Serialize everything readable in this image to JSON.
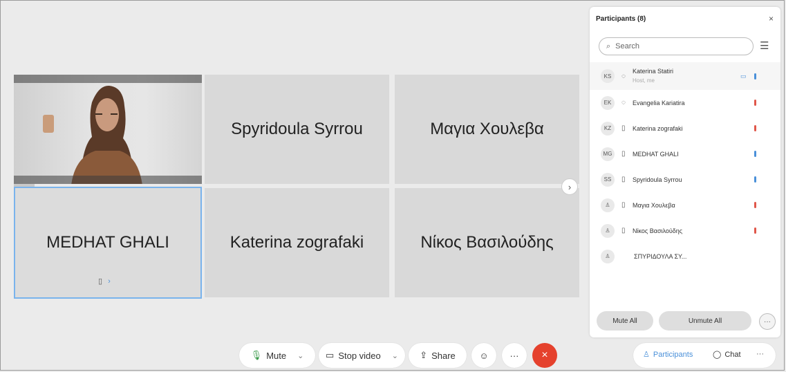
{
  "grid": {
    "tiles": [
      {
        "name": "Spyridoula Syrrou"
      },
      {
        "name": "Μαγια Χουλεβα"
      },
      {
        "name": "MEDHAT GHALI"
      },
      {
        "name": "Katerina zografaki"
      },
      {
        "name": "Νίκος Βασιλούδης"
      }
    ],
    "next_icon": "chevron-right-icon"
  },
  "controls": {
    "mute_label": "Mute",
    "stop_video_label": "Stop video",
    "share_label": "Share",
    "more_label": "···",
    "end_icon": "×"
  },
  "panel": {
    "title": "Participants (8)",
    "close": "×",
    "search_placeholder": "Search",
    "participants": [
      {
        "initials": "KS",
        "name": "Katerina Statiri",
        "sub": "Host, me",
        "mic": "blue",
        "video": true
      },
      {
        "initials": "EK",
        "name": "Evangelia Kariatira",
        "sub": "",
        "mic": "red"
      },
      {
        "initials": "KZ",
        "name": "Katerina zografaki",
        "sub": "",
        "mic": "red"
      },
      {
        "initials": "MG",
        "name": "MEDHAT GHALI",
        "sub": "",
        "mic": "blue"
      },
      {
        "initials": "SS",
        "name": "Spyridoula Syrrou",
        "sub": "",
        "mic": "blue"
      },
      {
        "initials": "",
        "name": "Μαγια Χουλεβα",
        "sub": "",
        "mic": "red"
      },
      {
        "initials": "",
        "name": "Νίκος Βασιλούδης",
        "sub": "",
        "mic": "red"
      },
      {
        "initials": "",
        "name": "ΣΠΥΡΙΔΟΥΛΑ ΣΥ...",
        "sub": "",
        "mic": ""
      }
    ],
    "mute_all": "Mute All",
    "unmute_all": "Unmute All",
    "more": "···"
  },
  "tabs": {
    "participants": "Participants",
    "chat": "Chat",
    "more": "···"
  },
  "colors": {
    "accent": "#4a90d9",
    "end_call": "#e5412d",
    "mic_red": "#e0574a"
  }
}
